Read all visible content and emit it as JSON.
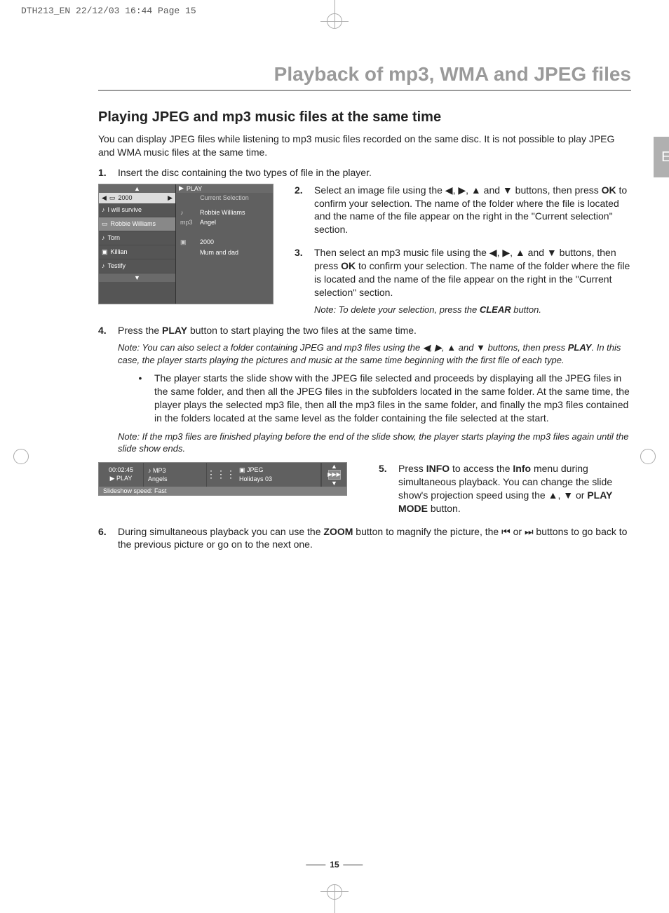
{
  "print_header": "DTH213_EN  22/12/03  16:44  Page 15",
  "lang_tab": "EN",
  "chapter_title": "Playback of mp3, WMA and JPEG files",
  "section_title": "Playing JPEG and mp3 music files at the same time",
  "intro": "You can display JPEG files while listening to mp3 music files recorded on the same disc. It is not possible to play JPEG and WMA music files at the same time.",
  "step1_num": "1.",
  "step1": "Insert the disc containing the two types of file in the player.",
  "step2_num": "2.",
  "step2_a": "Select an image file using the ",
  "step2_b": " buttons, then press ",
  "step2_ok": "OK",
  "step2_c": " to confirm your selection. The name of the folder where the file is located and the name of the file appear on the right in the \"Current selection\" section.",
  "step3_num": "3.",
  "step3_a": "Then select an mp3 music file using the ",
  "step3_b": " buttons, then press ",
  "step3_ok": "OK",
  "step3_c": " to confirm your selection. The name of the folder where the file is located and the name of the file appear on the right in the \"Current selection\" section.",
  "note_clear_a": "Note: To delete your selection, press the ",
  "note_clear_b": "CLEAR",
  "note_clear_c": " button.",
  "step4_num": "4.",
  "step4_a": "Press the ",
  "step4_play": "PLAY",
  "step4_b": " button to start playing the two files at the same time.",
  "note4_a": "Note: You can also select a folder containing JPEG and mp3 files using the ",
  "note4_b": " buttons, then press ",
  "note4_play": "PLAY",
  "note4_c": ". In this case, the player starts playing the pictures and music at the same time beginning with the first file of each type.",
  "bullet1": "The player starts the slide show with the JPEG file selected and proceeds by displaying all the JPEG files in the same folder, and then all the JPEG files in the subfolders located in the same folder. At the same time, the player plays the selected mp3 file, then all the mp3 files in the same folder, and finally the mp3 files contained in the folders located at the same level as the folder containing the file selected at the start.",
  "note_mp3": "Note: If the mp3 files are finished playing before the end of the slide show, the player starts playing the mp3 files again until the slide show ends.",
  "step5_num": "5.",
  "step5_a": "Press ",
  "step5_info": "INFO",
  "step5_b": " to access the ",
  "step5_info2": "Info",
  "step5_c": " menu during simultaneous playback. You can change the slide show's projection speed using the ",
  "step5_or": " or ",
  "step5_pm": "PLAY MODE",
  "step5_d": " button.",
  "step6_num": "6.",
  "step6_a": "During simultaneous playback you can use the ",
  "step6_zoom": "ZOOM",
  "step6_b": " button to magnify the picture, the ",
  "step6_c": " or ",
  "step6_d": " buttons to go back to the previous picture or go on to the next one.",
  "pagenum": "15",
  "sep_comma": ", ",
  "sep_and": " and ",
  "fig1": {
    "play_hdr": "PLAY",
    "folder": "2000",
    "current_sel": "Current Selection",
    "items": [
      "I will survive",
      "Robbie Williams",
      "Torn",
      "Killian",
      "Testify"
    ],
    "right_rows": [
      {
        "icon": "♪",
        "value": "Robbie Williams"
      },
      {
        "icon": "mp3",
        "value": "Angel"
      },
      {
        "icon": "▣",
        "value": "2000"
      },
      {
        "icon": "",
        "value": "Mum and dad"
      }
    ]
  },
  "fig2": {
    "time": "00:02:45",
    "play_label": "PLAY",
    "mp3_label": "MP3",
    "track": "Angels",
    "jpeg_label": "JPEG",
    "album": "Holidays 03",
    "bottom": "Slideshow speed: Fast"
  }
}
